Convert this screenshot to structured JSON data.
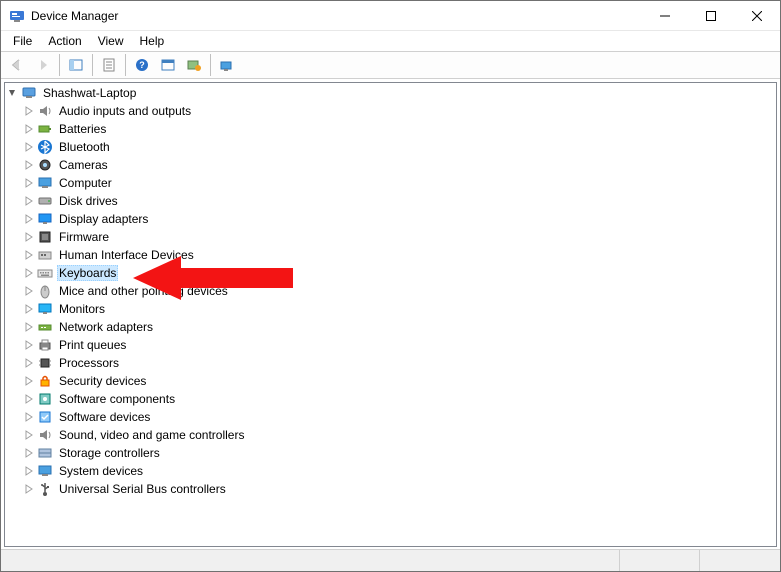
{
  "window": {
    "title": "Device Manager"
  },
  "menu": {
    "file": "File",
    "action": "Action",
    "view": "View",
    "help": "Help"
  },
  "tree": {
    "root": "Shashwat-Laptop",
    "items": [
      {
        "label": "Audio inputs and outputs",
        "icon": "audio"
      },
      {
        "label": "Batteries",
        "icon": "battery"
      },
      {
        "label": "Bluetooth",
        "icon": "bluetooth"
      },
      {
        "label": "Cameras",
        "icon": "camera"
      },
      {
        "label": "Computer",
        "icon": "computer"
      },
      {
        "label": "Disk drives",
        "icon": "disk"
      },
      {
        "label": "Display adapters",
        "icon": "display"
      },
      {
        "label": "Firmware",
        "icon": "firmware"
      },
      {
        "label": "Human Interface Devices",
        "icon": "hid"
      },
      {
        "label": "Keyboards",
        "icon": "keyboard",
        "selected": true
      },
      {
        "label": "Mice and other pointing devices",
        "icon": "mouse"
      },
      {
        "label": "Monitors",
        "icon": "monitor"
      },
      {
        "label": "Network adapters",
        "icon": "network"
      },
      {
        "label": "Print queues",
        "icon": "printer"
      },
      {
        "label": "Processors",
        "icon": "cpu"
      },
      {
        "label": "Security devices",
        "icon": "security"
      },
      {
        "label": "Software components",
        "icon": "softcomp"
      },
      {
        "label": "Software devices",
        "icon": "softdev"
      },
      {
        "label": "Sound, video and game controllers",
        "icon": "sound"
      },
      {
        "label": "Storage controllers",
        "icon": "storage"
      },
      {
        "label": "System devices",
        "icon": "system"
      },
      {
        "label": "Universal Serial Bus controllers",
        "icon": "usb"
      }
    ]
  },
  "annotation": {
    "arrow_color": "#f31414",
    "points_at": "Keyboards"
  }
}
